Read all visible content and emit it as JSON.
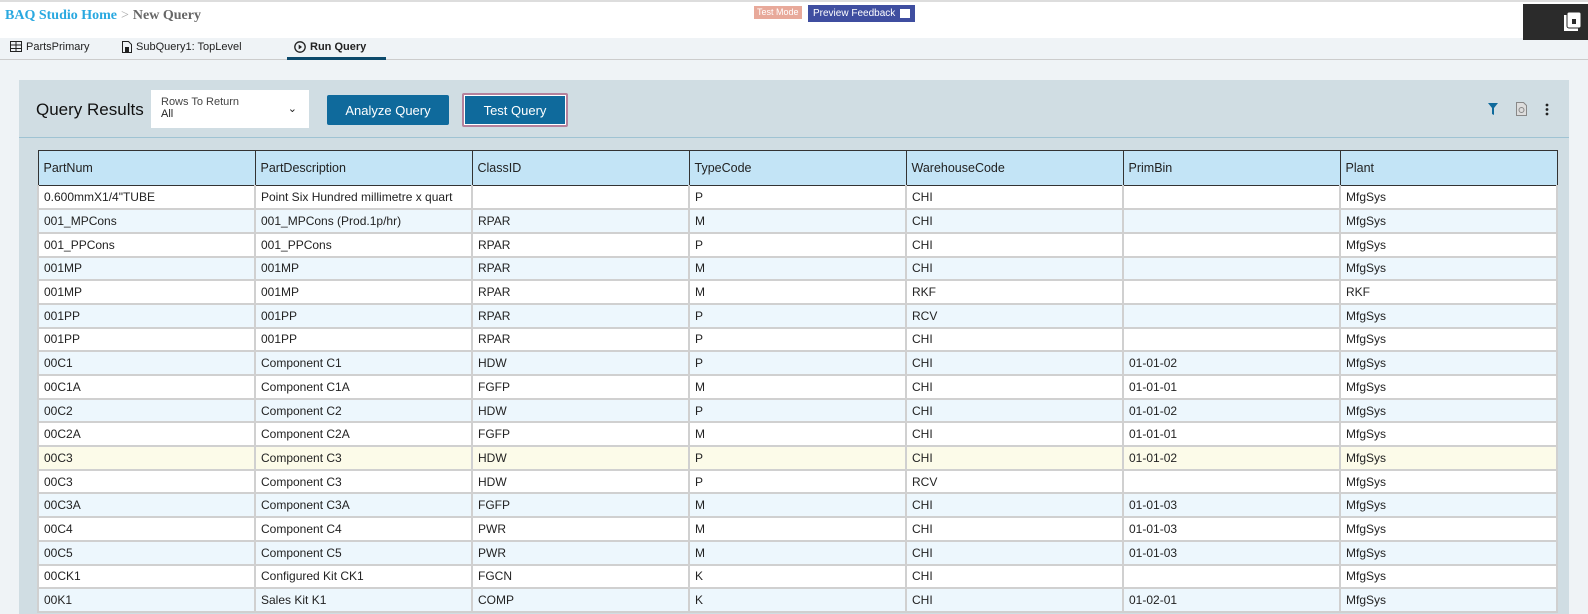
{
  "breadcrumb": {
    "home": "BAQ Studio Home",
    "separator": ">",
    "current": "New Query"
  },
  "badges": {
    "test_mode": "Test Mode",
    "preview_feedback": "Preview Feedback"
  },
  "tabs": [
    {
      "label": "PartsPrimary",
      "icon": "table-icon"
    },
    {
      "label": "SubQuery1: TopLevel",
      "icon": "document-icon"
    },
    {
      "label": "Run Query",
      "icon": "play-circle-icon",
      "active": true
    }
  ],
  "panel": {
    "title": "Query Results",
    "rows_to_return": {
      "label": "Rows To Return",
      "value": "All"
    },
    "analyze_label": "Analyze Query",
    "test_label": "Test Query"
  },
  "colors": {
    "accent": "#0f6a9c",
    "header": "#c3e4f6"
  },
  "table": {
    "columns": [
      "PartNum",
      "PartDescription",
      "ClassID",
      "TypeCode",
      "WarehouseCode",
      "PrimBin",
      "Plant"
    ],
    "rows": [
      [
        "0.600mmX1/4\"TUBE",
        "Point Six Hundred millimetre x quart",
        "",
        "P",
        "CHI",
        "",
        "MfgSys"
      ],
      [
        "001_MPCons",
        "001_MPCons (Prod.1p/hr)",
        "RPAR",
        "M",
        "CHI",
        "",
        "MfgSys"
      ],
      [
        "001_PPCons",
        "001_PPCons",
        "RPAR",
        "P",
        "CHI",
        "",
        "MfgSys"
      ],
      [
        "001MP",
        "001MP",
        "RPAR",
        "M",
        "CHI",
        "",
        "MfgSys"
      ],
      [
        "001MP",
        "001MP",
        "RPAR",
        "M",
        "RKF",
        "",
        "RKF"
      ],
      [
        "001PP",
        "001PP",
        "RPAR",
        "P",
        "RCV",
        "",
        "MfgSys"
      ],
      [
        "001PP",
        "001PP",
        "RPAR",
        "P",
        "CHI",
        "",
        "MfgSys"
      ],
      [
        "00C1",
        "Component C1",
        "HDW",
        "P",
        "CHI",
        "01-01-02",
        "MfgSys"
      ],
      [
        "00C1A",
        "Component C1A",
        "FGFP",
        "M",
        "CHI",
        "01-01-01",
        "MfgSys"
      ],
      [
        "00C2",
        "Component C2",
        "HDW",
        "P",
        "CHI",
        "01-01-02",
        "MfgSys"
      ],
      [
        "00C2A",
        "Component C2A",
        "FGFP",
        "M",
        "CHI",
        "01-01-01",
        "MfgSys"
      ],
      [
        "00C3",
        "Component C3",
        "HDW",
        "P",
        "CHI",
        "01-01-02",
        "MfgSys"
      ],
      [
        "00C3",
        "Component C3",
        "HDW",
        "P",
        "RCV",
        "",
        "MfgSys"
      ],
      [
        "00C3A",
        "Component C3A",
        "FGFP",
        "M",
        "CHI",
        "01-01-03",
        "MfgSys"
      ],
      [
        "00C4",
        "Component C4",
        "PWR",
        "M",
        "CHI",
        "01-01-03",
        "MfgSys"
      ],
      [
        "00C5",
        "Component C5",
        "PWR",
        "M",
        "CHI",
        "01-01-03",
        "MfgSys"
      ],
      [
        "00CK1",
        "Configured Kit CK1",
        "FGCN",
        "K",
        "CHI",
        "",
        "MfgSys"
      ],
      [
        "00K1",
        "Sales Kit K1",
        "COMP",
        "K",
        "CHI",
        "01-02-01",
        "MfgSys"
      ]
    ],
    "hover_row": 11
  }
}
